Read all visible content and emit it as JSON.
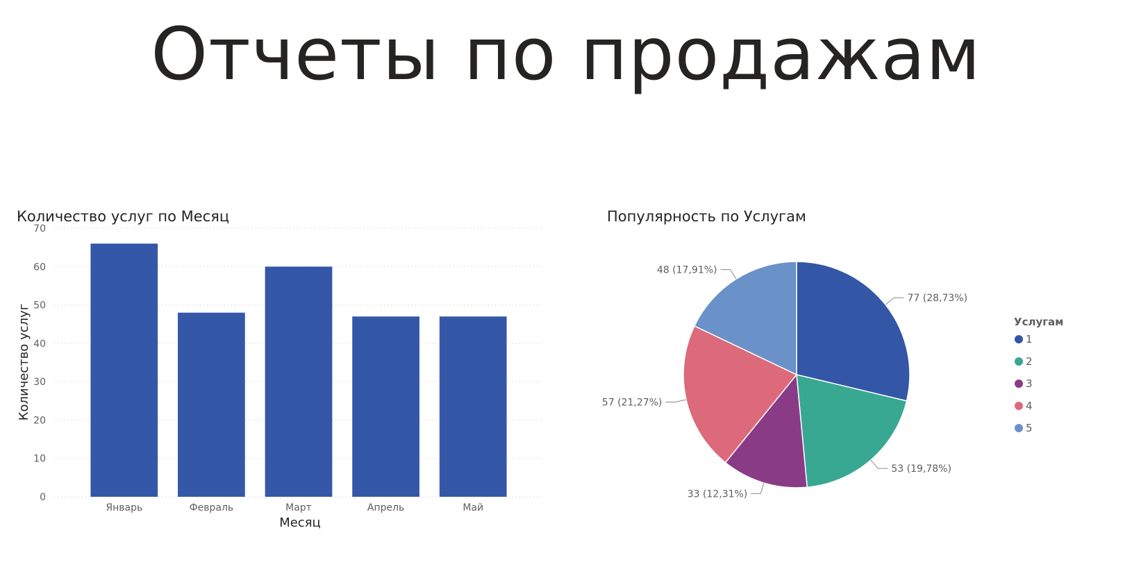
{
  "page": {
    "title": "Отчеты по продажам"
  },
  "chart_data": [
    {
      "type": "bar",
      "title": "Количество услуг по Месяц",
      "xlabel": "Месяц",
      "ylabel": "Количество услуг",
      "categories": [
        "Январь",
        "Февраль",
        "Март",
        "Апрель",
        "Май"
      ],
      "values": [
        66,
        48,
        60,
        47,
        47
      ],
      "ylim": [
        0,
        70
      ],
      "yticks": [
        "0",
        "10",
        "20",
        "30",
        "40",
        "50",
        "60",
        "70"
      ],
      "grid": true,
      "bar_color": "#3557a8"
    },
    {
      "type": "pie",
      "title": "Популярность по Услугам",
      "legend_title": "Услугам",
      "legend_position": "right",
      "slices": [
        {
          "name": "1",
          "value": 77,
          "label": "77 (28,73%)",
          "color": "#3357a6"
        },
        {
          "name": "2",
          "value": 53,
          "label": "53 (19,78%)",
          "color": "#38a892"
        },
        {
          "name": "3",
          "value": 33,
          "label": "33 (12,31%)",
          "color": "#8a3b86"
        },
        {
          "name": "4",
          "value": 57,
          "label": "57 (21,27%)",
          "color": "#dc6a7b"
        },
        {
          "name": "5",
          "value": 48,
          "label": "48 (17,91%)",
          "color": "#6b91c9"
        }
      ]
    }
  ]
}
